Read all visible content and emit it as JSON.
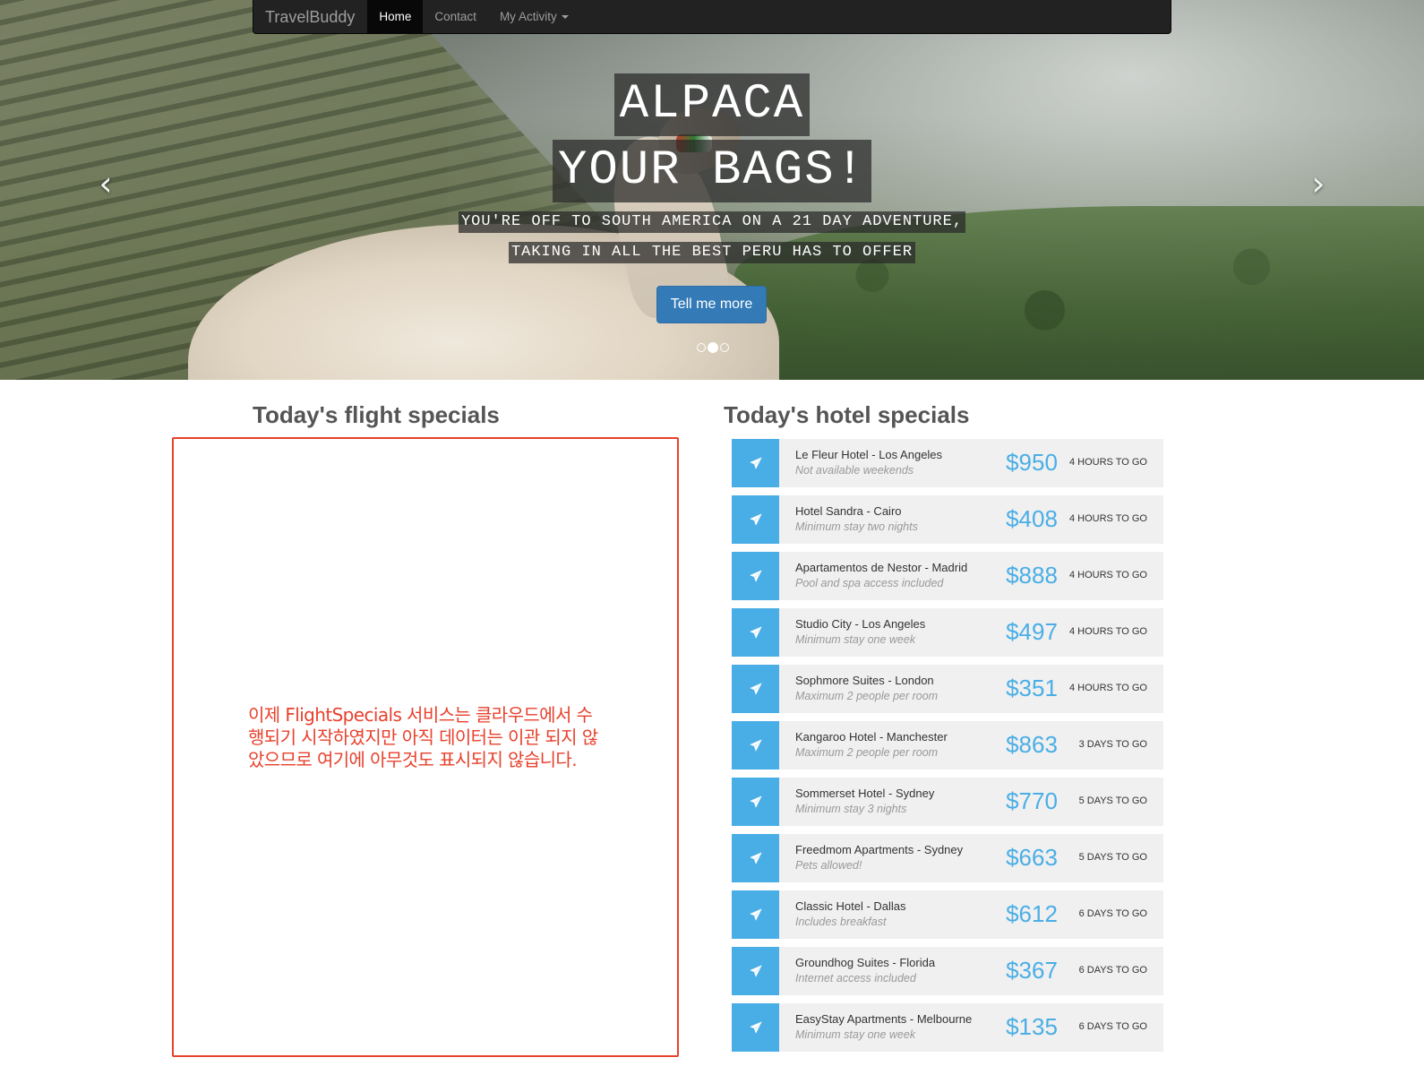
{
  "navbar": {
    "brand": "TravelBuddy",
    "items": [
      {
        "label": "Home"
      },
      {
        "label": "Contact"
      },
      {
        "label": "My Activity"
      }
    ]
  },
  "hero": {
    "headline_1": "ALPACA",
    "headline_2": "YOUR BAGS!",
    "sub_1": "YOU'RE OFF TO SOUTH AMERICA ON A 21 DAY ADVENTURE,",
    "sub_2": "TAKING IN ALL THE BEST PERU HAS TO OFFER",
    "cta": "Tell me more",
    "slide_count": 3,
    "active_slide": 2,
    "prev_icon": "chevron-left-icon",
    "next_icon": "chevron-right-icon"
  },
  "flights": {
    "title": "Today's flight specials",
    "note": "이제 FlightSpecials 서비스는 클라우드에서 수행되기 시작하였지만 아직 데이터는 이관 되지 않았으므로 여기에 아무것도 표시되지 않습니다."
  },
  "hotels": {
    "title": "Today's hotel specials",
    "icon": "paper-plane-icon",
    "items": [
      {
        "name": "Le Fleur Hotel - Los Angeles",
        "note": "Not available weekends",
        "price": "$950",
        "time": "4 hours to go"
      },
      {
        "name": "Hotel Sandra - Cairo",
        "note": "Minimum stay two nights",
        "price": "$408",
        "time": "4 hours to go"
      },
      {
        "name": "Apartamentos de Nestor - Madrid",
        "note": "Pool and spa access included",
        "price": "$888",
        "time": "4 hours to go"
      },
      {
        "name": "Studio City - Los Angeles",
        "note": "Minimum stay one week",
        "price": "$497",
        "time": "4 hours to go"
      },
      {
        "name": "Sophmore Suites - London",
        "note": "Maximum 2 people per room",
        "price": "$351",
        "time": "4 hours to go"
      },
      {
        "name": "Kangaroo Hotel - Manchester",
        "note": "Maximum 2 people per room",
        "price": "$863",
        "time": "3 days to go"
      },
      {
        "name": "Sommerset Hotel - Sydney",
        "note": "Minimum stay 3 nights",
        "price": "$770",
        "time": "5 days to go"
      },
      {
        "name": "Freedmom Apartments - Sydney",
        "note": "Pets allowed!",
        "price": "$663",
        "time": "5 days to go"
      },
      {
        "name": "Classic Hotel - Dallas",
        "note": "Includes breakfast",
        "price": "$612",
        "time": "6 days to go"
      },
      {
        "name": "Groundhog Suites - Florida",
        "note": "Internet access included",
        "price": "$367",
        "time": "6 days to go"
      },
      {
        "name": "EasyStay Apartments - Melbourne",
        "note": "Minimum stay one week",
        "price": "$135",
        "time": "6 days to go"
      }
    ]
  },
  "colors": {
    "accent": "#4aaee6",
    "annotation": "#e8412d",
    "navbar": "#222222",
    "cta": "#337ab7"
  }
}
